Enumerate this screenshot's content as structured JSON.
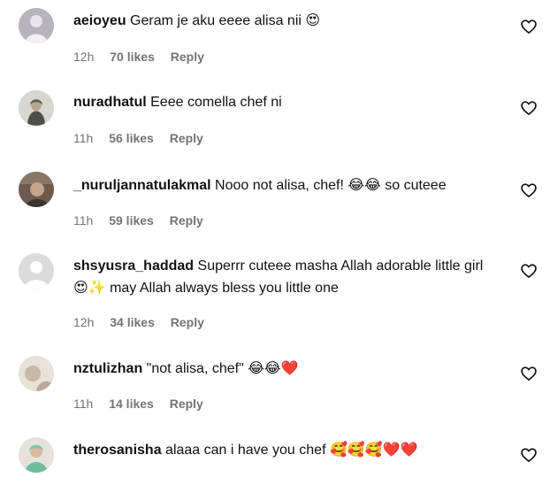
{
  "comments": [
    {
      "username": "aeioyeu",
      "text": "Geram je aku eeee alisa nii",
      "emoji": "😍",
      "time": "12h",
      "likes": "70 likes",
      "reply": "Reply"
    },
    {
      "username": "nuradhatul",
      "text": "Eeee comella chef ni",
      "emoji": "",
      "time": "11h",
      "likes": "56 likes",
      "reply": "Reply"
    },
    {
      "username": "_nuruljannatulakmal",
      "text": "Nooo not alisa, chef!",
      "emoji": "😂😂",
      "text2": "so cuteee",
      "time": "11h",
      "likes": "59 likes",
      "reply": "Reply"
    },
    {
      "username": "shsyusra_haddad",
      "text": "Superrr cuteee masha Allah adorable little girl",
      "emoji": "😍✨",
      "text2": "may Allah always bless you little one",
      "time": "12h",
      "likes": "34 likes",
      "reply": "Reply"
    },
    {
      "username": "nztulizhan",
      "text": "\"not alisa, chef\"",
      "emoji": "😂😂❤️",
      "time": "11h",
      "likes": "14 likes",
      "reply": "Reply"
    },
    {
      "username": "therosanisha",
      "text": "alaaa can i have you chef",
      "emoji": "🥰🥰🥰❤️❤️",
      "time": "",
      "likes": "",
      "reply": ""
    }
  ],
  "icons": {
    "like": "heart-outline-icon"
  },
  "colors": {
    "meta": "#737373",
    "text": "#111111",
    "heart": "#e0245e"
  }
}
